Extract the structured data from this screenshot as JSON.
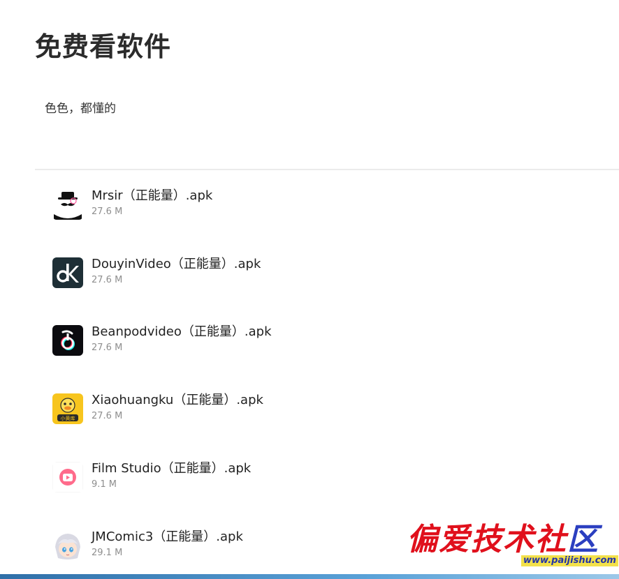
{
  "page": {
    "title": "免费看软件",
    "description": "色色，都懂的"
  },
  "files": [
    {
      "name": "Mrsir（正能量）.apk",
      "size": "27.6 M",
      "icon": "mrsir-app-icon"
    },
    {
      "name": "DouyinVideo（正能量）.apk",
      "size": "27.6 M",
      "icon": "douyin-app-icon"
    },
    {
      "name": "Beanpodvideo（正能量）.apk",
      "size": "27.6 M",
      "icon": "beanpod-app-icon"
    },
    {
      "name": "Xiaohuangku（正能量）.apk",
      "size": "27.6 M",
      "icon": "duck-app-icon"
    },
    {
      "name": "Film Studio（正能量）.apk",
      "size": "9.1 M",
      "icon": "film-studio-app-icon"
    },
    {
      "name": "JMComic3（正能量）.apk",
      "size": "29.1 M",
      "icon": "jmcomic-app-icon"
    }
  ],
  "icon_labels": {
    "duck_badge": "小黄库"
  },
  "watermark": {
    "logo_main": "偏爱技术社",
    "logo_tail": "区",
    "url": "www.paijishu.com"
  },
  "colors": {
    "accent_red": "#e0101c",
    "accent_blue": "#2b3fc0",
    "divider": "#ebebeb",
    "muted_text": "#8e8e8e"
  }
}
